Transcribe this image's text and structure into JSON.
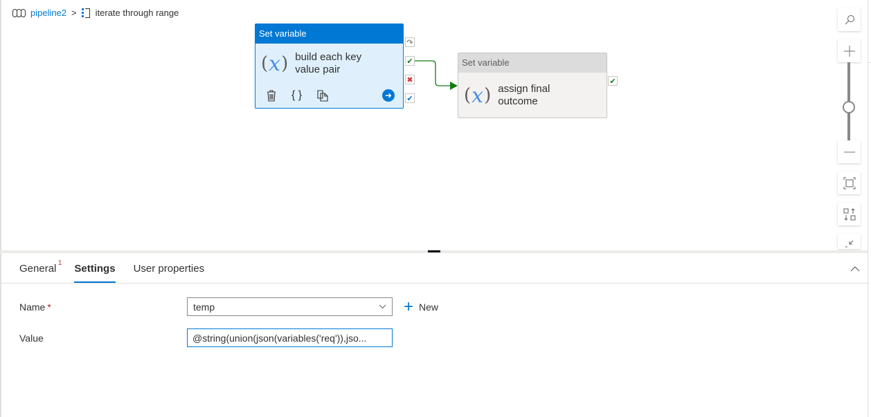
{
  "breadcrumb": {
    "pipeline_icon": "pipeline-icon",
    "pipeline": "pipeline2",
    "separator": ">",
    "activity_icon": "foreach-icon",
    "activity": "iterate through range"
  },
  "activities": [
    {
      "type": "Set variable",
      "name_line1": "build each key",
      "name_line2": "value pair",
      "selected": true,
      "icon": "variable-icon",
      "tools": [
        "delete-icon",
        "code-icon",
        "copy-icon",
        "go-arrow-icon"
      ]
    },
    {
      "type": "Set variable",
      "name_line1": "assign final",
      "name_line2": "outcome",
      "selected": false,
      "icon": "variable-icon"
    }
  ],
  "ports": {
    "skipped": "↷",
    "success": "✔",
    "failure": "✖",
    "completion": "✔"
  },
  "fx": {
    "open": "(",
    "var": "x",
    "close": ")"
  },
  "toolbar": {
    "search": "search-icon",
    "zoom_in": "zoom-in-icon",
    "zoom_level": 0.5,
    "zoom_out": "zoom-out-icon",
    "fit": "fit-to-screen-icon",
    "auto_align": "auto-align-icon",
    "collapse": "collapse-icon"
  },
  "panel": {
    "tabs": [
      {
        "label": "General",
        "badge": "1"
      },
      {
        "label": "Settings",
        "active": true
      },
      {
        "label": "User properties"
      }
    ],
    "name_label": "Name",
    "required_mark": "*",
    "name_value": "temp",
    "new_label": "New",
    "value_label": "Value",
    "value_text": "@string(union(json(variables('req')),jso..."
  },
  "colors": {
    "accent": "#0078d4",
    "success": "#107c10",
    "failure": "#d13438",
    "selected_card_bg": "#dff0fc"
  }
}
